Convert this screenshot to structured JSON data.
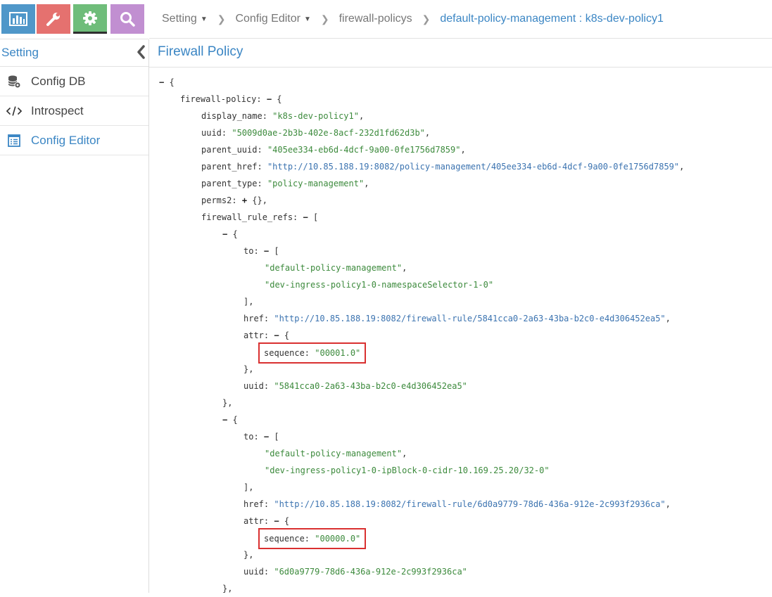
{
  "nav": {
    "buttons": [
      {
        "name": "monitor",
        "icon": "bar-chart-icon",
        "color": "#4f97c9"
      },
      {
        "name": "configure",
        "icon": "wrench-icon",
        "color": "#e5716f"
      },
      {
        "name": "setting",
        "icon": "gear-icon",
        "color": "#6fbd7a",
        "active": true
      },
      {
        "name": "query",
        "icon": "search-icon",
        "color": "#c18fd1"
      }
    ]
  },
  "sidebar": {
    "title": "Setting",
    "items": [
      {
        "label": "Config DB",
        "icon": "database-icon"
      },
      {
        "label": "Introspect",
        "icon": "code-icon"
      },
      {
        "label": "Config Editor",
        "icon": "editor-icon",
        "active": true
      }
    ]
  },
  "breadcrumb": {
    "item1": "Setting",
    "item2": "Config Editor",
    "item3": "firewall-policys",
    "item4": "default-policy-management : k8s-dev-policy1"
  },
  "page": {
    "title": "Firewall Policy"
  },
  "json": {
    "lines": [
      {
        "indent": 0,
        "tog": "−",
        "tail": " {"
      },
      {
        "indent": 1,
        "key": "firewall-policy",
        "tog": "−",
        "tail": " {"
      },
      {
        "indent": 2,
        "key": "display_name",
        "val": "\"k8s-dev-policy1\"",
        "comma": ","
      },
      {
        "indent": 2,
        "key": "uuid",
        "val": "\"5009d0ae-2b3b-402e-8acf-232d1fd62d3b\"",
        "comma": ","
      },
      {
        "indent": 2,
        "key": "parent_uuid",
        "val": "\"405ee334-eb6d-4dcf-9a00-0fe1756d7859\"",
        "comma": ","
      },
      {
        "indent": 2,
        "key": "parent_href",
        "link": "\"http://10.85.188.19:8082/policy-management/405ee334-eb6d-4dcf-9a00-0fe1756d7859\"",
        "comma": ","
      },
      {
        "indent": 2,
        "key": "parent_type",
        "val": "\"policy-management\"",
        "comma": ","
      },
      {
        "indent": 2,
        "key": "perms2",
        "tog": "+",
        "tail": " {},"
      },
      {
        "indent": 2,
        "key": "firewall_rule_refs",
        "tog": "−",
        "tail": " ["
      },
      {
        "indent": 3,
        "tog": "−",
        "tail": " {"
      },
      {
        "indent": 4,
        "key": "to",
        "tog": "−",
        "tail": " ["
      },
      {
        "indent": 5,
        "val": "\"default-policy-management\"",
        "comma": ","
      },
      {
        "indent": 5,
        "val": "\"dev-ingress-policy1-0-namespaceSelector-1-0\""
      },
      {
        "indent": 4,
        "text": "],"
      },
      {
        "indent": 4,
        "key": "href",
        "link": "\"http://10.85.188.19:8082/firewall-rule/5841cca0-2a63-43ba-b2c0-e4d306452ea5\"",
        "comma": ","
      },
      {
        "indent": 4,
        "key": "attr",
        "tog": "−",
        "tail": " {"
      },
      {
        "indent": 5,
        "key": "sequence",
        "val": "\"00001.0\"",
        "highlight": true
      },
      {
        "indent": 4,
        "text": "},"
      },
      {
        "indent": 4,
        "key": "uuid",
        "val": "\"5841cca0-2a63-43ba-b2c0-e4d306452ea5\""
      },
      {
        "indent": 3,
        "text": "},"
      },
      {
        "indent": 3,
        "tog": "−",
        "tail": " {"
      },
      {
        "indent": 4,
        "key": "to",
        "tog": "−",
        "tail": " ["
      },
      {
        "indent": 5,
        "val": "\"default-policy-management\"",
        "comma": ","
      },
      {
        "indent": 5,
        "val": "\"dev-ingress-policy1-0-ipBlock-0-cidr-10.169.25.20/32-0\""
      },
      {
        "indent": 4,
        "text": "],"
      },
      {
        "indent": 4,
        "key": "href",
        "link": "\"http://10.85.188.19:8082/firewall-rule/6d0a9779-78d6-436a-912e-2c993f2936ca\"",
        "comma": ","
      },
      {
        "indent": 4,
        "key": "attr",
        "tog": "−",
        "tail": " {"
      },
      {
        "indent": 5,
        "key": "sequence",
        "val": "\"00000.0\"",
        "highlight": true
      },
      {
        "indent": 4,
        "text": "},"
      },
      {
        "indent": 4,
        "key": "uuid",
        "val": "\"6d0a9779-78d6-436a-912e-2c993f2936ca\""
      },
      {
        "indent": 3,
        "text": "},"
      }
    ]
  }
}
